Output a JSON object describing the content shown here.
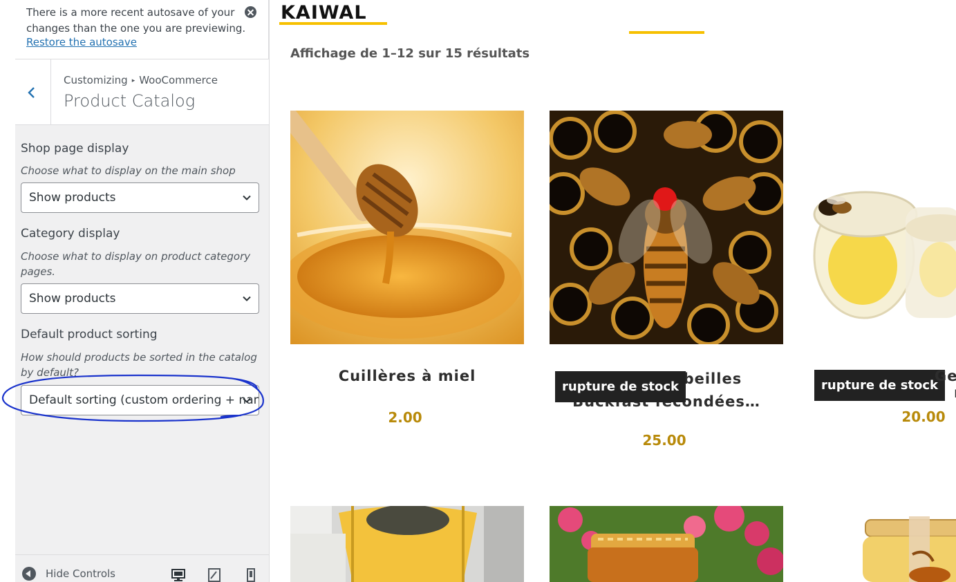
{
  "notice": {
    "text": "There is a more recent autosave of your changes than the one you are previewing.",
    "link": "Restore the autosave"
  },
  "section": {
    "breadcrumb_root": "Customizing",
    "breadcrumb_parent": "WooCommerce",
    "title": "Product Catalog"
  },
  "controls": {
    "shop_display": {
      "label": "Shop page display",
      "description": "Choose what to display on the main shop page.",
      "value": "Show products"
    },
    "category_display": {
      "label": "Category display",
      "description": "Choose what to display on product category pages.",
      "value": "Show products"
    },
    "default_sorting": {
      "label": "Default product sorting",
      "description": "How should products be sorted in the catalog by default?",
      "value": "Default sorting (custom ordering + nan"
    }
  },
  "footer": {
    "hide_controls": "Hide Controls"
  },
  "preview": {
    "logo": "KAIWAL",
    "result_count": "Affichage de 1–12 sur 15 résultats",
    "products": [
      {
        "title": "Cuillères à miel",
        "price": "2.00",
        "badge": ""
      },
      {
        "title_line1": "Reines d’abeilles",
        "title_line2": "Buckfast fécondées…",
        "price": "25.00",
        "badge": "rupture de stock"
      },
      {
        "title": "Gelée royale",
        "price": "20.00",
        "badge": "rupture de stock"
      }
    ]
  },
  "colors": {
    "accent_yellow": "#f6c000",
    "price": "#b88a0a",
    "wp_link": "#2271b1",
    "annotation_ink": "#1a33cc"
  }
}
